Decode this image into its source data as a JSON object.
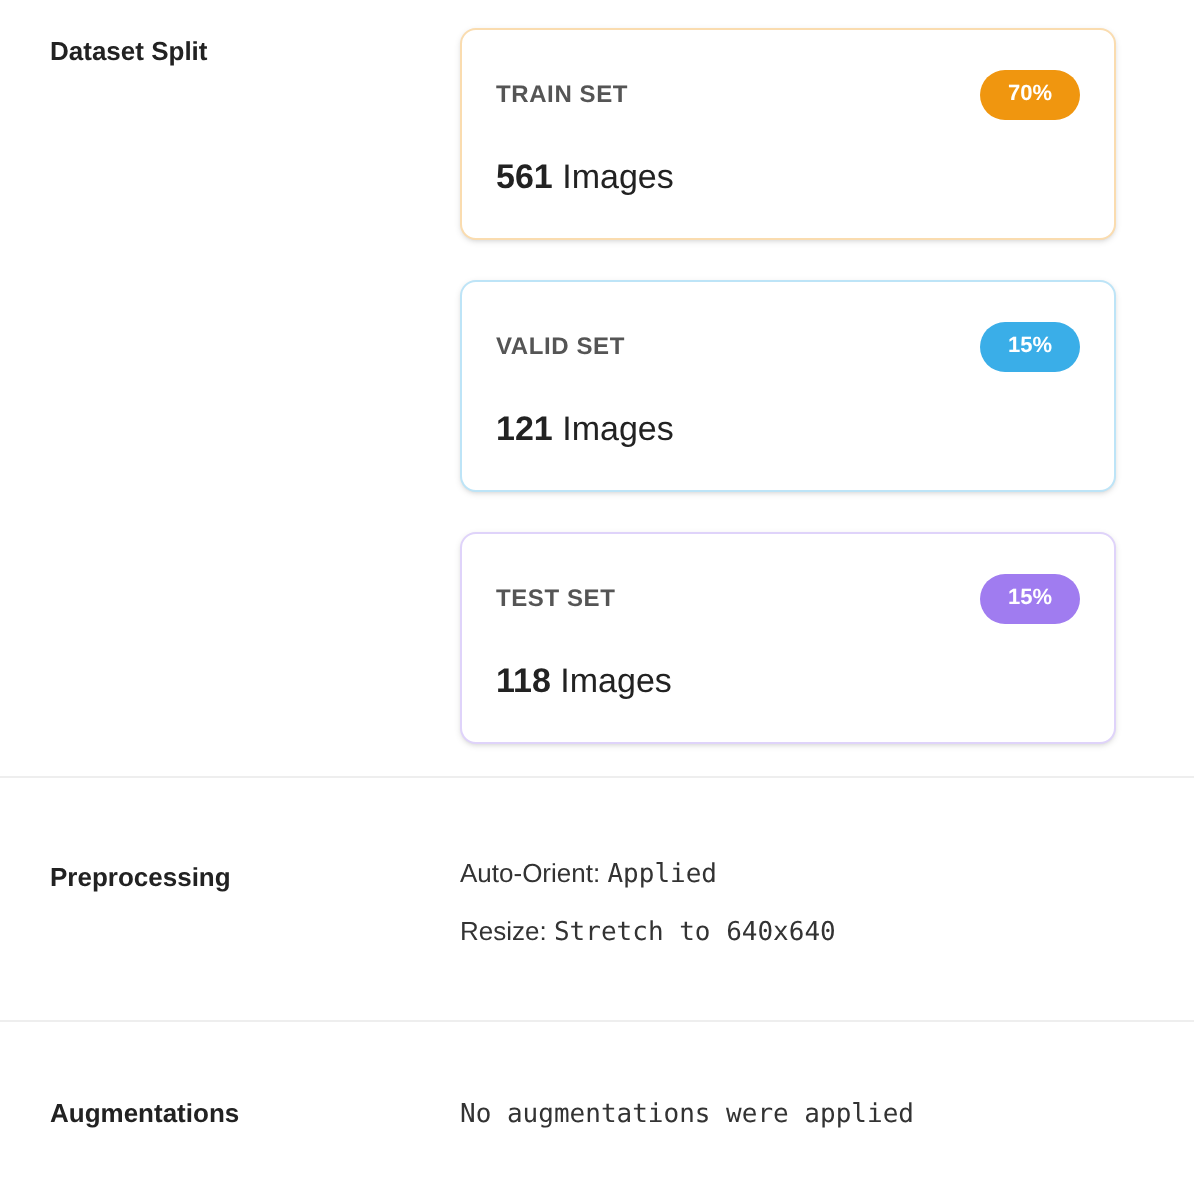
{
  "sections": [
    {
      "kind": "splits",
      "label": "Dataset Split",
      "splits": [
        {
          "name": "TRAIN SET",
          "percent": "70%",
          "color": "#f0960f",
          "count": "561",
          "unit": "Images"
        },
        {
          "name": "VALID SET",
          "percent": "15%",
          "color": "#3aaee8",
          "count": "121",
          "unit": "Images"
        },
        {
          "name": "TEST SET",
          "percent": "15%",
          "color": "#a07cf0",
          "count": "118",
          "unit": "Images"
        }
      ]
    },
    {
      "kind": "lines",
      "label": "Preprocessing",
      "lines": [
        {
          "key": "Auto-Orient:",
          "value": "Applied"
        },
        {
          "key": "Resize:",
          "value": "Stretch to 640x640"
        }
      ]
    },
    {
      "kind": "note",
      "label": "Augmentations",
      "text": "No augmentations were applied"
    }
  ]
}
